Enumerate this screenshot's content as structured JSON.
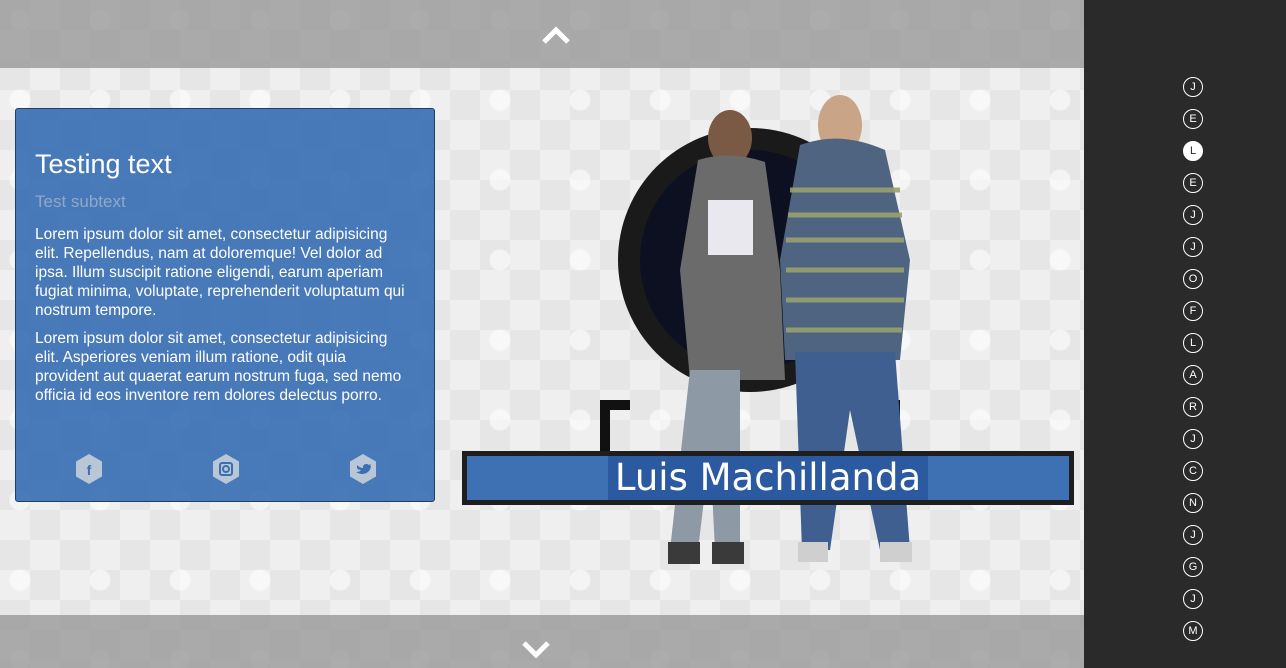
{
  "info_card": {
    "title": "Testing text",
    "subtitle": "Test subtext",
    "paragraphs": [
      "Lorem ipsum dolor sit amet, consectetur adipisicing elit. Repellendus, nam at doloremque! Vel dolor ad ipsa. Illum suscipit ratione eligendi, earum aperiam fugiat minima, voluptate, reprehenderit voluptatum qui nostrum tempore.",
      "Lorem ipsum dolor sit amet, consectetur adipisicing elit. Asperiores veniam illum ratione, odit quia provident aut quaerat earum nostrum fuga, sed nemo officia id eos inventore rem dolores delectus porro."
    ],
    "social": [
      {
        "icon": "facebook-icon",
        "glyph": "f"
      },
      {
        "icon": "instagram-icon",
        "glyph": "◘"
      },
      {
        "icon": "twitter-icon",
        "glyph": "t"
      }
    ]
  },
  "hero": {
    "name": "Luis Machillanda"
  },
  "sidebar": {
    "items": [
      {
        "letter": "J",
        "active": false
      },
      {
        "letter": "E",
        "active": false
      },
      {
        "letter": "L",
        "active": true
      },
      {
        "letter": "E",
        "active": false
      },
      {
        "letter": "J",
        "active": false
      },
      {
        "letter": "J",
        "active": false
      },
      {
        "letter": "O",
        "active": false
      },
      {
        "letter": "F",
        "active": false
      },
      {
        "letter": "L",
        "active": false
      },
      {
        "letter": "A",
        "active": false
      },
      {
        "letter": "R",
        "active": false
      },
      {
        "letter": "J",
        "active": false
      },
      {
        "letter": "C",
        "active": false
      },
      {
        "letter": "N",
        "active": false
      },
      {
        "letter": "J",
        "active": false
      },
      {
        "letter": "G",
        "active": false
      },
      {
        "letter": "J",
        "active": false
      },
      {
        "letter": "M",
        "active": false
      }
    ]
  },
  "colors": {
    "card_blue": "#3a6fb4",
    "sidebar_bg": "#2a2a2a",
    "nav_bar": "#969696"
  }
}
